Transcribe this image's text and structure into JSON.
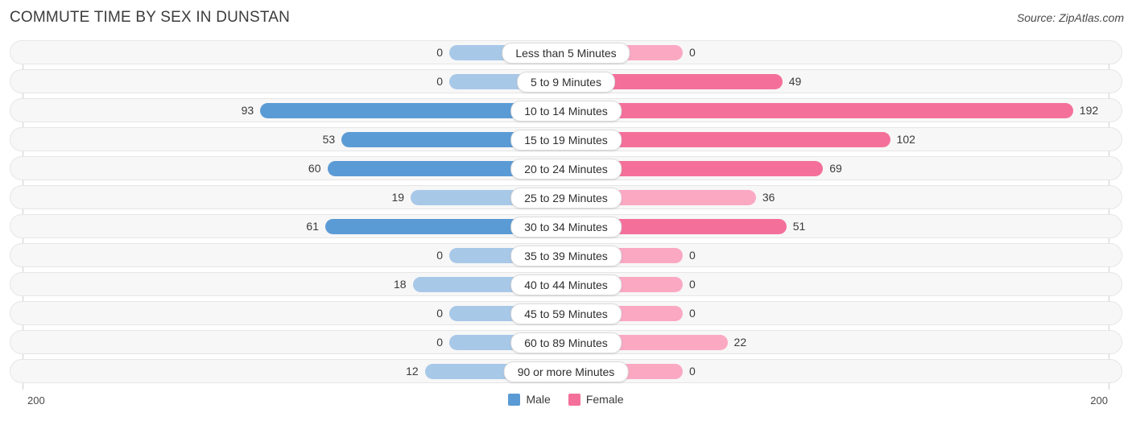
{
  "header": {
    "title": "COMMUTE TIME BY SEX IN DUNSTAN",
    "source": "Source: ZipAtlas.com"
  },
  "axis": {
    "min_label": "200",
    "max_label": "200",
    "max_value": 200
  },
  "legend": {
    "items": [
      {
        "label": "Male",
        "color": "#5b9bd5",
        "name": "legend-male"
      },
      {
        "label": "Female",
        "color": "#f4709a",
        "name": "legend-female"
      }
    ]
  },
  "colors": {
    "male_strong": "#5b9bd5",
    "male_light": "#a8c8e8",
    "female_strong": "#f4709a",
    "female_light": "#fba8c3",
    "track_bg": "#f7f7f7",
    "track_border": "#e6e6e6",
    "axis_line": "#cfcfcf"
  },
  "chart_data": {
    "type": "bar",
    "title": "COMMUTE TIME BY SEX IN DUNSTAN",
    "xlabel": "",
    "ylabel": "",
    "orientation": "horizontal-diverging",
    "xlim": [
      200,
      200
    ],
    "grid": false,
    "legend_position": "bottom-center",
    "categories": [
      "Less than 5 Minutes",
      "5 to 9 Minutes",
      "10 to 14 Minutes",
      "15 to 19 Minutes",
      "20 to 24 Minutes",
      "25 to 29 Minutes",
      "30 to 34 Minutes",
      "35 to 39 Minutes",
      "40 to 44 Minutes",
      "45 to 59 Minutes",
      "60 to 89 Minutes",
      "90 or more Minutes"
    ],
    "series": [
      {
        "name": "Male",
        "values": [
          0,
          0,
          93,
          53,
          60,
          19,
          61,
          0,
          18,
          0,
          0,
          12
        ]
      },
      {
        "name": "Female",
        "values": [
          0,
          49,
          192,
          102,
          69,
          36,
          51,
          0,
          0,
          0,
          22,
          0
        ]
      }
    ]
  },
  "rows": [
    {
      "label": "Less than 5 Minutes",
      "male": "0",
      "female": "0"
    },
    {
      "label": "5 to 9 Minutes",
      "male": "0",
      "female": "49"
    },
    {
      "label": "10 to 14 Minutes",
      "male": "93",
      "female": "192"
    },
    {
      "label": "15 to 19 Minutes",
      "male": "53",
      "female": "102"
    },
    {
      "label": "20 to 24 Minutes",
      "male": "60",
      "female": "69"
    },
    {
      "label": "25 to 29 Minutes",
      "male": "19",
      "female": "36"
    },
    {
      "label": "30 to 34 Minutes",
      "male": "61",
      "female": "51"
    },
    {
      "label": "35 to 39 Minutes",
      "male": "0",
      "female": "0"
    },
    {
      "label": "40 to 44 Minutes",
      "male": "18",
      "female": "0"
    },
    {
      "label": "45 to 59 Minutes",
      "male": "0",
      "female": "0"
    },
    {
      "label": "60 to 89 Minutes",
      "male": "0",
      "female": "22"
    },
    {
      "label": "90 or more Minutes",
      "male": "12",
      "female": "0"
    }
  ]
}
